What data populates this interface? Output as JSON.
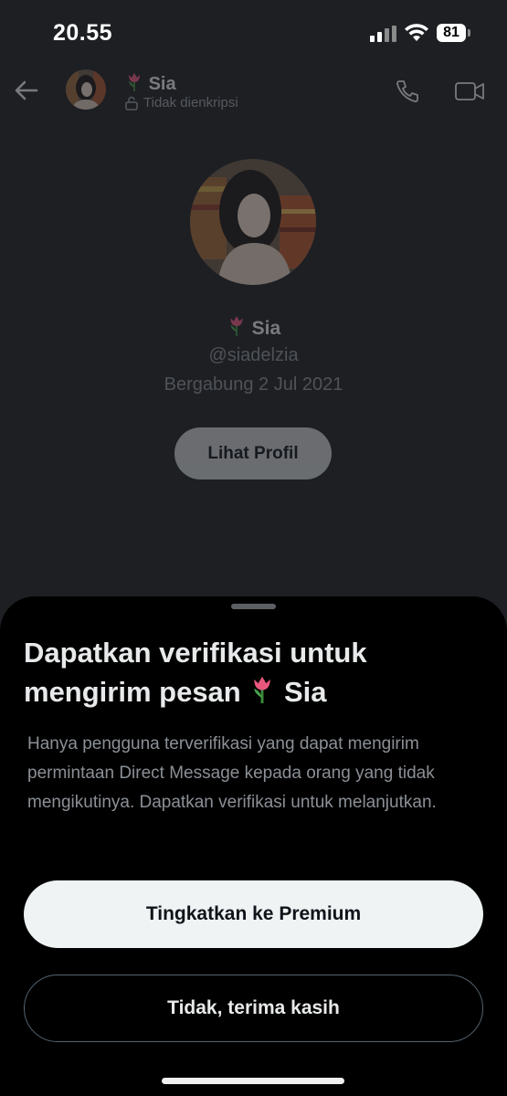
{
  "status_bar": {
    "time": "20.55",
    "battery": "81"
  },
  "header": {
    "name": "Sia",
    "subtitle": "Tidak dienkripsi"
  },
  "profile": {
    "name": "Sia",
    "handle": "@siadelzia",
    "joined": "Bergabung 2 Jul 2021",
    "view_profile_label": "Lihat Profil"
  },
  "sheet": {
    "title_text": "Dapatkan verifikasi untuk mengirim pesan",
    "title_name": "Sia",
    "description": "Hanya pengguna terverifikasi yang dapat mengirim permintaan Direct Message kepada orang yang tidak mengikutinya. Dapatkan verifikasi untuk melanjutkan.",
    "primary_label": "Tingkatkan ke Premium",
    "secondary_label": "Tidak, terima kasih"
  },
  "icons": [
    "tulip-emoji-icon",
    "back-arrow-icon",
    "unlock-icon",
    "phone-icon",
    "video-camera-icon",
    "signal-icon",
    "wifi-icon",
    "battery-icon"
  ],
  "colors": {
    "sheet_bg": "#000000",
    "screen_bg": "#1d1f23",
    "primary_button": "#eff3f4",
    "muted_text": "#8b9096"
  }
}
